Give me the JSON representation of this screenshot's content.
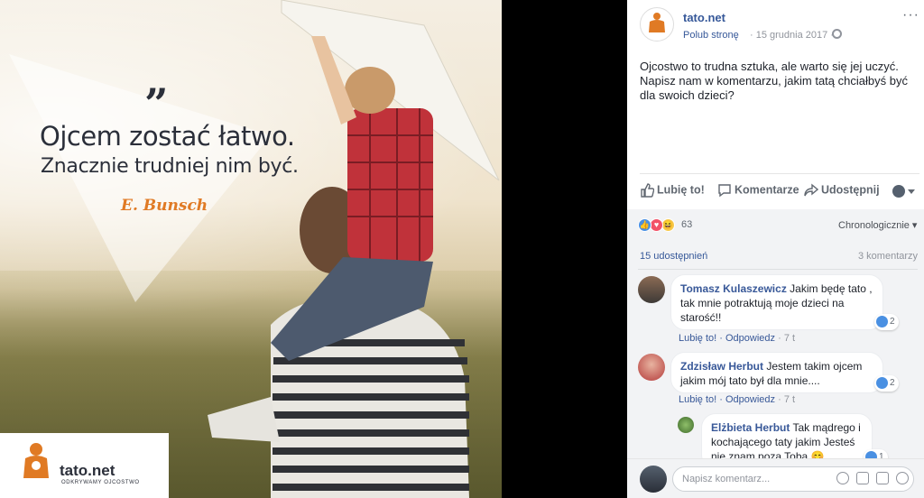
{
  "photo": {
    "quote_mark": "”",
    "quote_line1": "Ojcem zostać łatwo.",
    "quote_line2": "Znacznie trudniej nim być.",
    "quote_author": "E. Bunsch",
    "logo_text": "tato.net",
    "logo_tagline": "ODKRYWAMY OJCOSTWO"
  },
  "post": {
    "page_name": "tato.net",
    "like_page": "Polub stronę",
    "date": "· 15 grudnia 2017 ·",
    "more": "···",
    "text": "Ojcostwo to trudna sztuka, ale warto się jej uczyć. Napisz nam w komentarzu, jakim tatą chciałbyś być dla swoich dzieci?"
  },
  "actions": {
    "like": "Lubię to!",
    "comment": "Komentarze",
    "share": "Udostępnij"
  },
  "stats": {
    "reactions_count": "63",
    "sort_label": "Chronologicznie ▾",
    "shares": "15 udostępnień",
    "comments": "3 komentarzy"
  },
  "comments": [
    {
      "name": "Tomasz Kulaszewicz",
      "text_line1": " Jakim będę tato ,",
      "text_line2": "tak mnie potraktują moje dzieci na",
      "text_line3": "starość!!",
      "likes": "2",
      "like_label": "Lubię to!",
      "reply_label": "Odpowiedz",
      "age": "· 7 t"
    },
    {
      "name": "Zdzisław Herbut",
      "text_line1": " Jestem takim ojcem",
      "text_line2": "jakim mój tato był dla mnie....",
      "likes": "2",
      "like_label": "Lubię to!",
      "reply_label": "Odpowiedz",
      "age": "· 7 t"
    },
    {
      "name": "Elżbieta Herbut",
      "text_line1": " Tak mądrego i",
      "text_line2": "kochającego taty jakim Jesteś",
      "text_line3": "nie znam poza Toba 😊",
      "likes": "1"
    }
  ],
  "composer": {
    "placeholder": "Napisz komentarz..."
  },
  "colors": {
    "fb_blue": "#365899",
    "accent_orange": "#e07a24"
  }
}
